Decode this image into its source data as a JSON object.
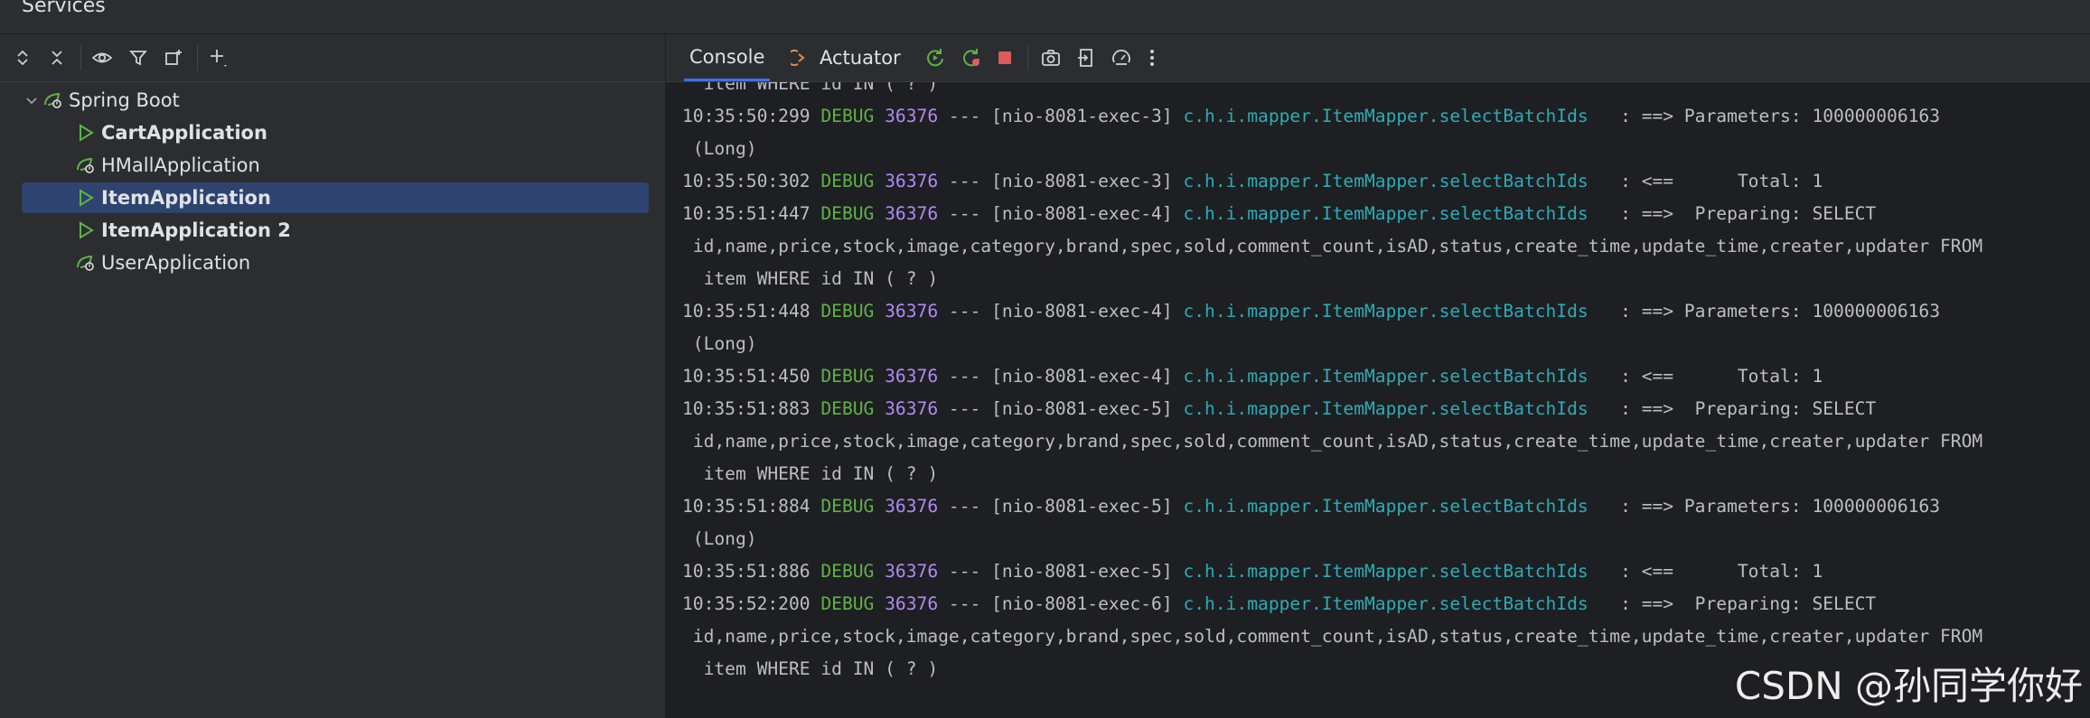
{
  "window": {
    "title": "Services"
  },
  "toolbar_left": {
    "icons": [
      "expand-all-icon",
      "collapse-all-icon",
      "eye-icon",
      "filter-icon",
      "new-group-icon",
      "add-icon"
    ]
  },
  "tree": {
    "root": {
      "label": "Spring Boot",
      "icon": "spring-boot-icon"
    },
    "items": [
      {
        "label": "CartApplication",
        "icon": "run-icon",
        "bold": true,
        "selected": false
      },
      {
        "label": "HMallApplication",
        "icon": "spring-boot-icon",
        "bold": false,
        "selected": false
      },
      {
        "label": "ItemApplication",
        "icon": "run-icon",
        "bold": true,
        "selected": true
      },
      {
        "label": "ItemApplication 2",
        "icon": "run-icon",
        "bold": true,
        "selected": false
      },
      {
        "label": "UserApplication",
        "icon": "spring-boot-icon",
        "bold": false,
        "selected": false
      }
    ]
  },
  "tabs": [
    {
      "label": "Console",
      "active": true
    },
    {
      "label": "Actuator",
      "active": false,
      "icon": "actuator-icon"
    }
  ],
  "toolbar_right": {
    "icons": [
      "rerun-icon",
      "rerun-failed-icon",
      "stop-icon",
      "camera-icon",
      "export-icon",
      "dashboard-icon",
      "more-icon"
    ]
  },
  "console": {
    "lines": [
      {
        "text": "  item WHERE id IN ( ? )"
      },
      {
        "time": "10:35:50:299",
        "level": "DEBUG",
        "pid": "36376",
        "thread": " --- [nio-8081-exec-3] ",
        "logger": "c.h.i.mapper.ItemMapper.selectBatchIds",
        "msg": "   : ==> Parameters: 100000006163"
      },
      {
        "text": " (Long)"
      },
      {
        "time": "10:35:50:302",
        "level": "DEBUG",
        "pid": "36376",
        "thread": " --- [nio-8081-exec-3] ",
        "logger": "c.h.i.mapper.ItemMapper.selectBatchIds",
        "msg": "   : <==      Total: 1"
      },
      {
        "time": "10:35:51:447",
        "level": "DEBUG",
        "pid": "36376",
        "thread": " --- [nio-8081-exec-4] ",
        "logger": "c.h.i.mapper.ItemMapper.selectBatchIds",
        "msg": "   : ==>  Preparing: SELECT"
      },
      {
        "text": " id,name,price,stock,image,category,brand,spec,sold,comment_count,isAD,status,create_time,update_time,creater,updater FROM"
      },
      {
        "text": "  item WHERE id IN ( ? )"
      },
      {
        "time": "10:35:51:448",
        "level": "DEBUG",
        "pid": "36376",
        "thread": " --- [nio-8081-exec-4] ",
        "logger": "c.h.i.mapper.ItemMapper.selectBatchIds",
        "msg": "   : ==> Parameters: 100000006163"
      },
      {
        "text": " (Long)"
      },
      {
        "time": "10:35:51:450",
        "level": "DEBUG",
        "pid": "36376",
        "thread": " --- [nio-8081-exec-4] ",
        "logger": "c.h.i.mapper.ItemMapper.selectBatchIds",
        "msg": "   : <==      Total: 1"
      },
      {
        "time": "10:35:51:883",
        "level": "DEBUG",
        "pid": "36376",
        "thread": " --- [nio-8081-exec-5] ",
        "logger": "c.h.i.mapper.ItemMapper.selectBatchIds",
        "msg": "   : ==>  Preparing: SELECT"
      },
      {
        "text": " id,name,price,stock,image,category,brand,spec,sold,comment_count,isAD,status,create_time,update_time,creater,updater FROM"
      },
      {
        "text": "  item WHERE id IN ( ? )"
      },
      {
        "time": "10:35:51:884",
        "level": "DEBUG",
        "pid": "36376",
        "thread": " --- [nio-8081-exec-5] ",
        "logger": "c.h.i.mapper.ItemMapper.selectBatchIds",
        "msg": "   : ==> Parameters: 100000006163"
      },
      {
        "text": " (Long)"
      },
      {
        "time": "10:35:51:886",
        "level": "DEBUG",
        "pid": "36376",
        "thread": " --- [nio-8081-exec-5] ",
        "logger": "c.h.i.mapper.ItemMapper.selectBatchIds",
        "msg": "   : <==      Total: 1"
      },
      {
        "time": "10:35:52:200",
        "level": "DEBUG",
        "pid": "36376",
        "thread": " --- [nio-8081-exec-6] ",
        "logger": "c.h.i.mapper.ItemMapper.selectBatchIds",
        "msg": "   : ==>  Preparing: SELECT"
      },
      {
        "text": " id,name,price,stock,image,category,brand,spec,sold,comment_count,isAD,status,create_time,update_time,creater,updater FROM"
      },
      {
        "text": "  item WHERE id IN ( ? )"
      }
    ]
  },
  "watermark": "CSDN @孙同学你好",
  "colors": {
    "debug": "#5fb346",
    "pid": "#b189f5",
    "logger": "#2aacb8",
    "selection": "#2e436e",
    "run_green": "#5fb346"
  }
}
